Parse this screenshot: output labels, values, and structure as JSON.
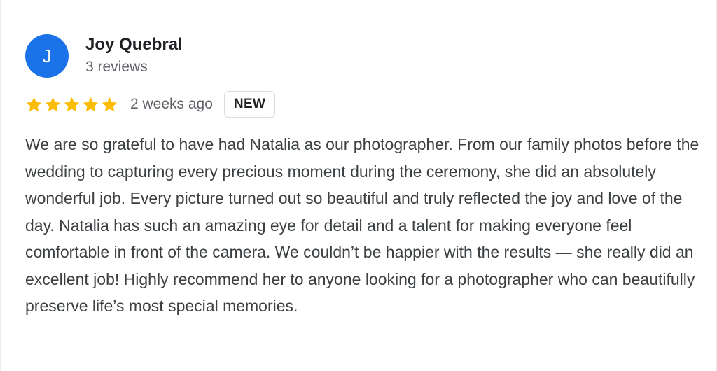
{
  "reviewer": {
    "initial": "J",
    "name": "Joy Quebral",
    "review_count": "3 reviews",
    "avatar_color": "#1a73e8"
  },
  "rating": {
    "stars": 5,
    "max_stars": 5,
    "star_color": "#fbbc04",
    "time": "2 weeks ago",
    "badge": "NEW"
  },
  "review": {
    "text": "We are so grateful to have had Natalia as our photographer. From our family photos before the wedding to capturing every precious moment during the ceremony, she did an absolutely wonderful job. Every picture turned out so beautiful and truly reflected the joy and love of the day. Natalia has such an amazing eye for detail and a talent for making everyone feel comfortable in front of the camera. We couldn’t be happier with the results — she really did an excellent job! Highly recommend her to anyone looking for a photographer who can beautifully preserve life’s most special memories."
  }
}
